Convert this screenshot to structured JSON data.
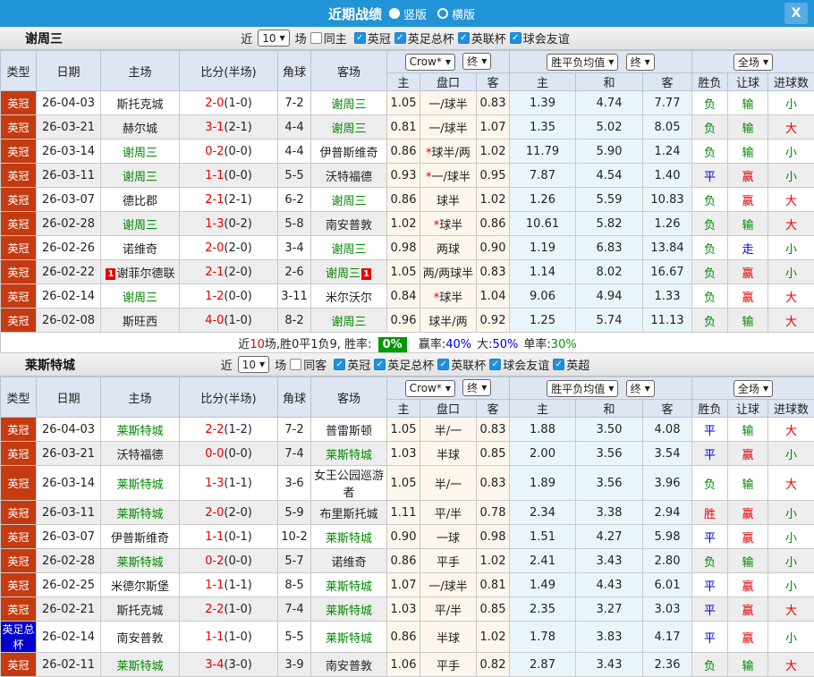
{
  "titlebar": {
    "title": "近期战绩",
    "layout_options": [
      {
        "label": "竖版",
        "selected": true
      },
      {
        "label": "横版",
        "selected": false
      }
    ],
    "close_label": "X"
  },
  "table_header": {
    "left_cols": [
      "类型",
      "日期",
      "主场",
      "比分(半场)",
      "角球",
      "客场"
    ],
    "sub_cols": [
      "主",
      "盘口",
      "客",
      "主",
      "和",
      "客",
      "胜负",
      "让球",
      "进球数"
    ],
    "bookmaker_select": "Crow*",
    "final_select_1": "终",
    "avg_select": "胜平负均值",
    "final_select_2": "终",
    "scope_select": "全场"
  },
  "colors": {
    "titlebar_blue": "#2094d6",
    "league_red": "#c43a11",
    "league_blue": "#0000cd",
    "win_red": "#e60000",
    "draw_blue": "#0000e0",
    "loss_green": "#008800"
  },
  "sections": [
    {
      "team": "谢周三",
      "filter": {
        "near_label": "近",
        "near_value": "10",
        "games_label": "场",
        "same_label": "同主",
        "same_checked": false,
        "leagues": [
          {
            "label": "英冠",
            "checked": true
          },
          {
            "label": "英足总杯",
            "checked": true
          },
          {
            "label": "英联杯",
            "checked": true
          },
          {
            "label": "球会友谊",
            "checked": true
          }
        ]
      },
      "rows": [
        {
          "type": "英冠",
          "date": "26-04-03",
          "home": "斯托克城",
          "score": "2-0",
          "half": "(1-0)",
          "corner": "7-2",
          "away": "谢周三",
          "odds_h": "1.05",
          "handicap": "一/球半",
          "odds_a": "0.83",
          "avg_h": "1.39",
          "avg_d": "4.74",
          "avg_a": "7.77",
          "result": "负",
          "let_result": "输",
          "goal_result": "小"
        },
        {
          "type": "英冠",
          "date": "26-03-21",
          "home": "赫尔城",
          "score": "3-1",
          "half": "(2-1)",
          "corner": "4-4",
          "away": "谢周三",
          "odds_h": "0.81",
          "handicap": "一/球半",
          "odds_a": "1.07",
          "avg_h": "1.35",
          "avg_d": "5.02",
          "avg_a": "8.05",
          "result": "负",
          "let_result": "输",
          "goal_result": "大"
        },
        {
          "type": "英冠",
          "date": "26-03-14",
          "home": "谢周三",
          "score": "0-2",
          "half": "(0-0)",
          "corner": "4-4",
          "away": "伊普斯维奇",
          "odds_h": "0.86",
          "handicap": "*球半/两",
          "odds_a": "1.02",
          "avg_h": "11.79",
          "avg_d": "5.90",
          "avg_a": "1.24",
          "result": "负",
          "let_result": "输",
          "goal_result": "小"
        },
        {
          "type": "英冠",
          "date": "26-03-11",
          "home": "谢周三",
          "score": "1-1",
          "half": "(0-0)",
          "corner": "5-5",
          "away": "沃特福德",
          "odds_h": "0.93",
          "handicap": "*一/球半",
          "odds_a": "0.95",
          "avg_h": "7.87",
          "avg_d": "4.54",
          "avg_a": "1.40",
          "result": "平",
          "let_result": "赢",
          "goal_result": "小"
        },
        {
          "type": "英冠",
          "date": "26-03-07",
          "home": "德比郡",
          "score": "2-1",
          "half": "(2-1)",
          "corner": "6-2",
          "away": "谢周三",
          "odds_h": "0.86",
          "handicap": "球半",
          "odds_a": "1.02",
          "avg_h": "1.26",
          "avg_d": "5.59",
          "avg_a": "10.83",
          "result": "负",
          "let_result": "赢",
          "goal_result": "大"
        },
        {
          "type": "英冠",
          "date": "26-02-28",
          "home": "谢周三",
          "score": "1-3",
          "half": "(0-2)",
          "corner": "5-8",
          "away": "南安普敦",
          "odds_h": "1.02",
          "handicap": "*球半",
          "odds_a": "0.86",
          "avg_h": "10.61",
          "avg_d": "5.82",
          "avg_a": "1.26",
          "result": "负",
          "let_result": "输",
          "goal_result": "大"
        },
        {
          "type": "英冠",
          "date": "26-02-26",
          "home": "诺维奇",
          "score": "2-0",
          "half": "(2-0)",
          "corner": "3-4",
          "away": "谢周三",
          "odds_h": "0.98",
          "handicap": "两球",
          "odds_a": "0.90",
          "avg_h": "1.19",
          "avg_d": "6.83",
          "avg_a": "13.84",
          "result": "负",
          "let_result": "走",
          "goal_result": "小"
        },
        {
          "type": "英冠",
          "date": "26-02-22",
          "home": "谢菲尔德联",
          "home_rc": "1",
          "score": "2-1",
          "half": "(2-0)",
          "corner": "2-6",
          "away": "谢周三",
          "away_rc": "1",
          "odds_h": "1.05",
          "handicap": "两/两球半",
          "odds_a": "0.83",
          "avg_h": "1.14",
          "avg_d": "8.02",
          "avg_a": "16.67",
          "result": "负",
          "let_result": "赢",
          "goal_result": "小"
        },
        {
          "type": "英冠",
          "date": "26-02-14",
          "home": "谢周三",
          "score": "1-2",
          "half": "(0-0)",
          "corner": "3-11",
          "away": "米尔沃尔",
          "odds_h": "0.84",
          "handicap": "*球半",
          "odds_a": "1.04",
          "avg_h": "9.06",
          "avg_d": "4.94",
          "avg_a": "1.33",
          "result": "负",
          "let_result": "赢",
          "goal_result": "大"
        },
        {
          "type": "英冠",
          "date": "26-02-08",
          "home": "斯旺西",
          "score": "4-0",
          "half": "(1-0)",
          "corner": "8-2",
          "away": "谢周三",
          "odds_h": "0.96",
          "handicap": "球半/两",
          "odds_a": "0.92",
          "avg_h": "1.25",
          "avg_d": "5.74",
          "avg_a": "11.13",
          "result": "负",
          "let_result": "输",
          "goal_result": "大"
        }
      ],
      "summary": {
        "lead": "近",
        "count": "10",
        "mid": "场,胜0平1负9, 胜率:",
        "rate": "0%",
        "stats": [
          {
            "label": "赢率:",
            "value": "40%",
            "color": "blue"
          },
          {
            "label": "大:",
            "value": "50%",
            "color": "blue"
          },
          {
            "label": "单率:",
            "value": "30%",
            "color": "green"
          }
        ]
      }
    },
    {
      "team": "莱斯特城",
      "filter": {
        "near_label": "近",
        "near_value": "10",
        "games_label": "场",
        "same_label": "同客",
        "same_checked": false,
        "leagues": [
          {
            "label": "英冠",
            "checked": true
          },
          {
            "label": "英足总杯",
            "checked": true
          },
          {
            "label": "英联杯",
            "checked": true
          },
          {
            "label": "球会友谊",
            "checked": true
          },
          {
            "label": "英超",
            "checked": true
          }
        ]
      },
      "rows": [
        {
          "type": "英冠",
          "date": "26-04-03",
          "home": "莱斯特城",
          "score": "2-2",
          "half": "(1-2)",
          "corner": "7-2",
          "away": "普雷斯顿",
          "odds_h": "1.05",
          "handicap": "半/一",
          "odds_a": "0.83",
          "avg_h": "1.88",
          "avg_d": "3.50",
          "avg_a": "4.08",
          "result": "平",
          "let_result": "输",
          "goal_result": "大"
        },
        {
          "type": "英冠",
          "date": "26-03-21",
          "home": "沃特福德",
          "score": "0-0",
          "half": "(0-0)",
          "corner": "7-4",
          "away": "莱斯特城",
          "odds_h": "1.03",
          "handicap": "半球",
          "odds_a": "0.85",
          "avg_h": "2.00",
          "avg_d": "3.56",
          "avg_a": "3.54",
          "result": "平",
          "let_result": "赢",
          "goal_result": "小"
        },
        {
          "type": "英冠",
          "date": "26-03-14",
          "home": "莱斯特城",
          "score": "1-3",
          "half": "(1-1)",
          "corner": "3-6",
          "away": "女王公园巡游者",
          "odds_h": "1.05",
          "handicap": "半/一",
          "odds_a": "0.83",
          "avg_h": "1.89",
          "avg_d": "3.56",
          "avg_a": "3.96",
          "result": "负",
          "let_result": "输",
          "goal_result": "大"
        },
        {
          "type": "英冠",
          "date": "26-03-11",
          "home": "莱斯特城",
          "score": "2-0",
          "half": "(2-0)",
          "corner": "5-9",
          "away": "布里斯托城",
          "odds_h": "1.11",
          "handicap": "平/半",
          "odds_a": "0.78",
          "avg_h": "2.34",
          "avg_d": "3.38",
          "avg_a": "2.94",
          "result": "胜",
          "let_result": "赢",
          "goal_result": "小"
        },
        {
          "type": "英冠",
          "date": "26-03-07",
          "home": "伊普斯维奇",
          "score": "1-1",
          "half": "(0-1)",
          "corner": "10-2",
          "away": "莱斯特城",
          "odds_h": "0.90",
          "handicap": "一球",
          "odds_a": "0.98",
          "avg_h": "1.51",
          "avg_d": "4.27",
          "avg_a": "5.98",
          "result": "平",
          "let_result": "赢",
          "goal_result": "小"
        },
        {
          "type": "英冠",
          "date": "26-02-28",
          "home": "莱斯特城",
          "score": "0-2",
          "half": "(0-0)",
          "corner": "5-7",
          "away": "诺维奇",
          "odds_h": "0.86",
          "handicap": "平手",
          "odds_a": "1.02",
          "avg_h": "2.41",
          "avg_d": "3.43",
          "avg_a": "2.80",
          "result": "负",
          "let_result": "输",
          "goal_result": "小"
        },
        {
          "type": "英冠",
          "date": "26-02-25",
          "home": "米德尔斯堡",
          "score": "1-1",
          "half": "(1-1)",
          "corner": "8-5",
          "away": "莱斯特城",
          "odds_h": "1.07",
          "handicap": "一/球半",
          "odds_a": "0.81",
          "avg_h": "1.49",
          "avg_d": "4.43",
          "avg_a": "6.01",
          "result": "平",
          "let_result": "赢",
          "goal_result": "小"
        },
        {
          "type": "英冠",
          "date": "26-02-21",
          "home": "斯托克城",
          "score": "2-2",
          "half": "(1-0)",
          "corner": "7-4",
          "away": "莱斯特城",
          "odds_h": "1.03",
          "handicap": "平/半",
          "odds_a": "0.85",
          "avg_h": "2.35",
          "avg_d": "3.27",
          "avg_a": "3.03",
          "result": "平",
          "let_result": "赢",
          "goal_result": "大"
        },
        {
          "type": "英足总杯",
          "date": "26-02-14",
          "home": "南安普敦",
          "score": "1-1",
          "half": "(1-0)",
          "corner": "5-5",
          "away": "莱斯特城",
          "odds_h": "0.86",
          "handicap": "半球",
          "odds_a": "1.02",
          "avg_h": "1.78",
          "avg_d": "3.83",
          "avg_a": "4.17",
          "result": "平",
          "let_result": "赢",
          "goal_result": "小"
        },
        {
          "type": "英冠",
          "date": "26-02-11",
          "home": "莱斯特城",
          "score": "3-4",
          "half": "(3-0)",
          "corner": "3-9",
          "away": "南安普敦",
          "odds_h": "1.06",
          "handicap": "平手",
          "odds_a": "0.82",
          "avg_h": "2.87",
          "avg_d": "3.43",
          "avg_a": "2.36",
          "result": "负",
          "let_result": "输",
          "goal_result": "大"
        }
      ]
    }
  ]
}
